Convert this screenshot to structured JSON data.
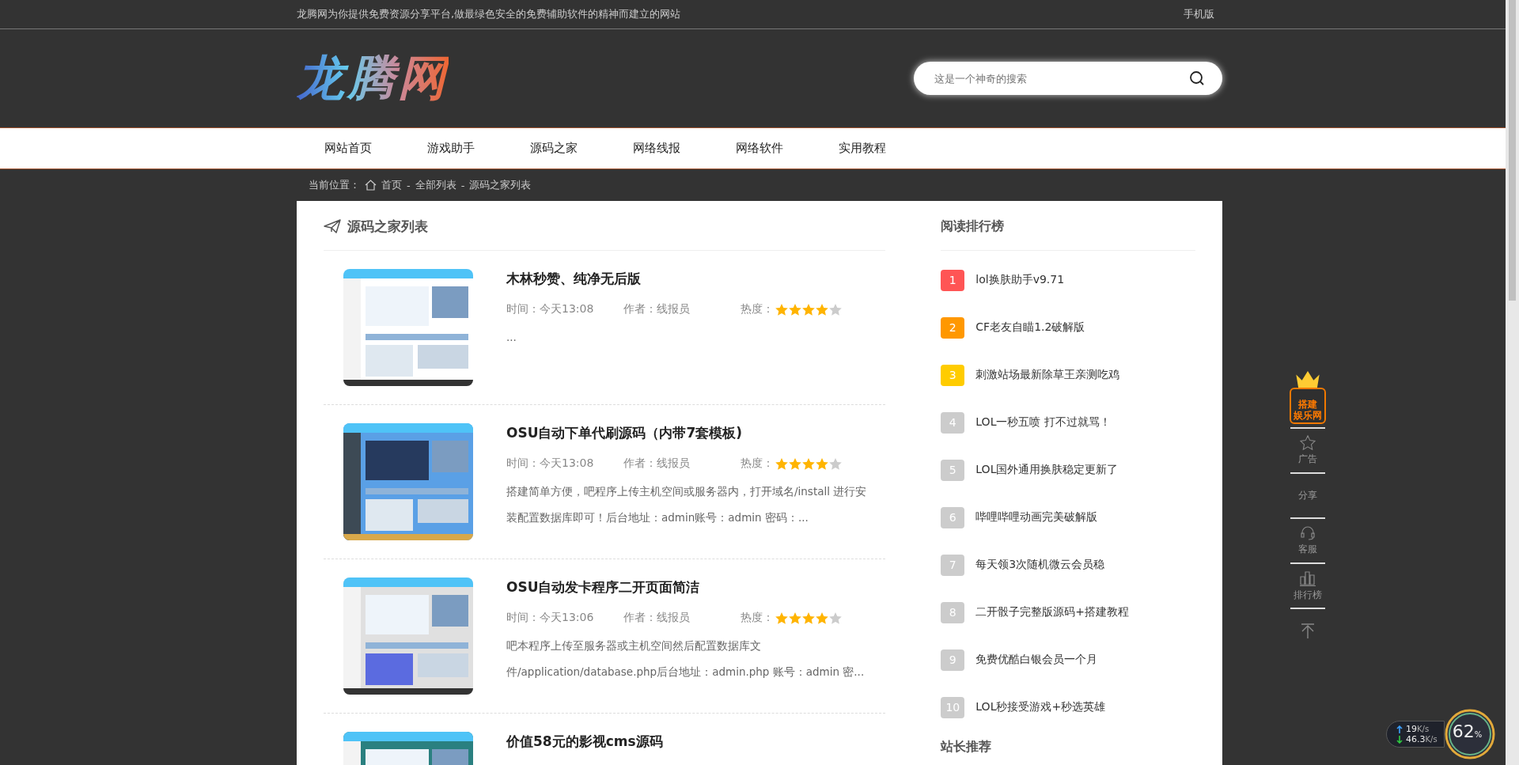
{
  "top_bar": {
    "slogan": "龙腾网为你提供免费资源分享平台,做最绿色安全的免费辅助软件的精神而建立的网站",
    "mobile_link": "手机版"
  },
  "header": {
    "logo": "龙腾网",
    "search": {
      "placeholder": "这是一个神奇的搜索"
    }
  },
  "nav": [
    {
      "label": "网站首页",
      "selected": false
    },
    {
      "label": "游戏助手",
      "selected": false
    },
    {
      "label": "源码之家",
      "selected": false
    },
    {
      "label": "网络线报",
      "selected": false
    },
    {
      "label": "网络软件",
      "selected": false
    },
    {
      "label": "实用教程",
      "selected": false
    }
  ],
  "breadcrumb": {
    "label": "当前位置：",
    "separator": "-",
    "links": [
      "首页",
      "全部列表",
      "源码之家列表"
    ]
  },
  "list": {
    "title": "源码之家列表",
    "articles": [
      {
        "title": "木林秒赞、纯净无后版",
        "time": "时间：今天13:08",
        "author": "作者：线报员",
        "heat_label": "热度：",
        "stars": 4,
        "summary": "..."
      },
      {
        "title": "OSU自动下单代刷源码（内带7套模板)",
        "time": "时间：今天13:08",
        "author": "作者：线报员",
        "heat_label": "热度：",
        "stars": 4,
        "summary": "搭建简单方便，吧程序上传主机空间或服务器内，打开域名/install 进行安装配置数据库即可！后台地址：admin账号：admin  密码：..."
      },
      {
        "title": "OSU自动发卡程序二开页面简洁",
        "time": "时间：今天13:06",
        "author": "作者：线报员",
        "heat_label": "热度：",
        "stars": 4,
        "summary": "吧本程序上传至服务器或主机空间然后配置数据库文件/application/database.php后台地址：admin.php 账号：admin 密..."
      },
      {
        "title": "价值58元的影视cms源码"
      }
    ]
  },
  "ranking": {
    "title": "阅读排行榜",
    "items": [
      {
        "rank": "1",
        "title": "lol换肤助手v9.71",
        "color": "#ff5555"
      },
      {
        "rank": "2",
        "title": "CF老友自瞄1.2破解版",
        "color": "#ff9800"
      },
      {
        "rank": "3",
        "title": "刺激站场最新除草王亲测吃鸡",
        "color": "#ffcc00"
      },
      {
        "rank": "4",
        "title": "LOL一秒五喷 打不过就骂！",
        "color": "#cccccc"
      },
      {
        "rank": "5",
        "title": "LOL国外通用换肤稳定更新了",
        "color": "#cccccc"
      },
      {
        "rank": "6",
        "title": "哔哩哔哩动画完美破解版",
        "color": "#cccccc"
      },
      {
        "rank": "7",
        "title": "每天领3次随机微云会员稳",
        "color": "#cccccc"
      },
      {
        "rank": "8",
        "title": "二开骰子完整版源码+搭建教程",
        "color": "#cccccc"
      },
      {
        "rank": "9",
        "title": "免费优酷白银会员一个月",
        "color": "#cccccc"
      },
      {
        "rank": "10",
        "title": "LOL秒接受游戏+秒选英雄",
        "color": "#cccccc"
      }
    ],
    "next_title": "站长推荐"
  },
  "float_bar": {
    "badge": [
      "搭建",
      "娱乐网"
    ],
    "items": [
      {
        "kind": "star",
        "label": "广告"
      },
      {
        "kind": "text",
        "label": "分享"
      },
      {
        "kind": "headset",
        "label": "客服"
      },
      {
        "kind": "chart",
        "label": "排行榜"
      },
      {
        "kind": "top"
      }
    ]
  },
  "net_widget": {
    "upload": "19",
    "download": "46.3",
    "unit_up": "K/s",
    "unit_down": "K/s",
    "percent": "62",
    "percent_sign": "%"
  }
}
